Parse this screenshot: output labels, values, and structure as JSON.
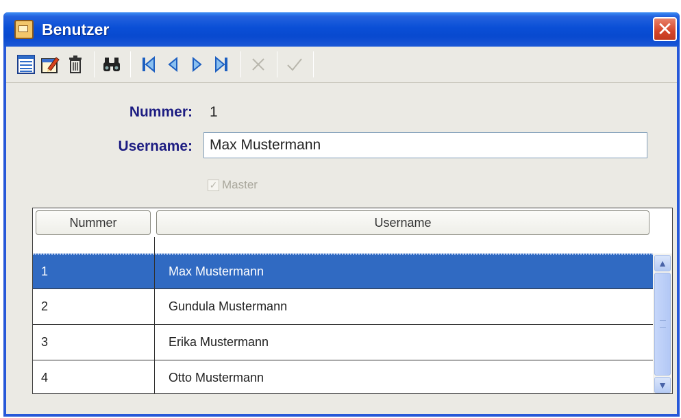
{
  "window": {
    "title": "Benutzer",
    "close_glyph": "✕"
  },
  "toolbar": {
    "buttons": [
      {
        "name": "list-view-icon",
        "enabled": true
      },
      {
        "name": "edit-icon",
        "enabled": true
      },
      {
        "name": "delete-icon",
        "enabled": true
      },
      {
        "name": "search-binoculars-icon",
        "enabled": true
      },
      {
        "name": "first-record-icon",
        "enabled": true
      },
      {
        "name": "previous-record-icon",
        "enabled": true
      },
      {
        "name": "next-record-icon",
        "enabled": true
      },
      {
        "name": "last-record-icon",
        "enabled": true
      },
      {
        "name": "cancel-icon",
        "enabled": false
      },
      {
        "name": "confirm-icon",
        "enabled": false
      }
    ]
  },
  "form": {
    "nummer_label": "Nummer:",
    "nummer_value": "1",
    "username_label": "Username:",
    "username_value": "Max Mustermann",
    "master_label": "Master",
    "master_checked": true,
    "master_enabled": false
  },
  "grid": {
    "columns": [
      "Nummer",
      "Username"
    ],
    "rows": [
      {
        "nummer": "1",
        "username": "Max Mustermann",
        "selected": true
      },
      {
        "nummer": "2",
        "username": "Gundula Mustermann",
        "selected": false
      },
      {
        "nummer": "3",
        "username": "Erika Mustermann",
        "selected": false
      },
      {
        "nummer": "4",
        "username": "Otto Mustermann",
        "selected": false
      }
    ]
  },
  "colors": {
    "title_bar": "#0a4fd6",
    "label_text": "#1d1d82",
    "selection": "#306ac2"
  }
}
